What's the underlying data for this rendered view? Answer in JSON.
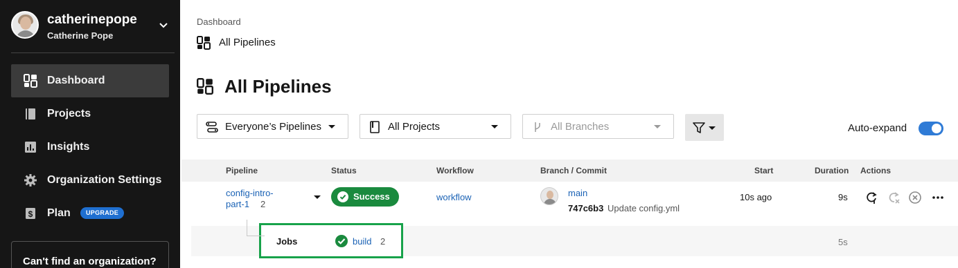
{
  "user": {
    "username": "catherinepope",
    "full_name": "Catherine Pope"
  },
  "sidebar": {
    "items": [
      {
        "label": "Dashboard",
        "icon": "dashboard-icon",
        "active": true
      },
      {
        "label": "Projects",
        "icon": "book-icon"
      },
      {
        "label": "Insights",
        "icon": "chart-icon"
      },
      {
        "label": "Organization Settings",
        "icon": "gear-icon"
      },
      {
        "label": "Plan",
        "icon": "dollar-icon",
        "badge": "UPGRADE"
      }
    ],
    "cant_find": "Can't find an organization?"
  },
  "breadcrumb": {
    "parent": "Dashboard",
    "current": "All Pipelines"
  },
  "page": {
    "title": "All Pipelines"
  },
  "filters": {
    "pipelines": "Everyone’s Pipelines",
    "projects": "All Projects",
    "branches": "All Branches"
  },
  "auto_expand": {
    "label": "Auto-expand",
    "on": true
  },
  "table": {
    "headers": [
      "Pipeline",
      "Status",
      "Workflow",
      "Branch / Commit",
      "Start",
      "Duration",
      "Actions"
    ],
    "row": {
      "pipeline": "config-intro-part-1",
      "pipeline_count": "2",
      "status": "Success",
      "workflow": "workflow",
      "branch": "main",
      "commit_hash": "747c6b3",
      "commit_message": "Update config.yml",
      "start": "10s ago",
      "duration": "9s"
    },
    "jobs": {
      "label": "Jobs",
      "job_name": "build",
      "job_count": "2",
      "duration": "5s"
    }
  },
  "colors": {
    "sidebar_bg": "#161616",
    "success": "#1a8a3e",
    "link": "#1a62b5",
    "highlight": "#17a24a",
    "toggle": "#2f7bd6"
  }
}
